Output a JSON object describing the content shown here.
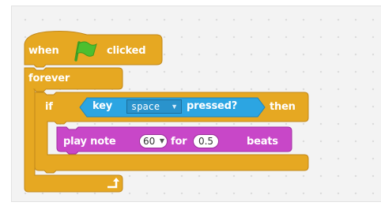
{
  "workspace": {
    "background": "#f3f3f3"
  },
  "script": {
    "hat_block": {
      "word_when": "when",
      "flag_icon": "green-flag-icon",
      "word_clicked": "clicked",
      "color": "#e6a822"
    },
    "forever_block": {
      "label": "forever",
      "loop_arrow_icon": "loop-arrow-icon",
      "color": "#e6a822"
    },
    "if_block": {
      "word_if": "if",
      "word_then": "then",
      "color": "#e6a822"
    },
    "condition_block": {
      "word_key": "key",
      "key_value": "space",
      "word_pressed": "pressed?",
      "color": "#2ca5e2"
    },
    "play_note_block": {
      "word_play_note": "play note",
      "note_value": "60",
      "word_for": "for",
      "beats_value": "0.5",
      "word_beats": "beats",
      "color": "#c847c8"
    }
  }
}
